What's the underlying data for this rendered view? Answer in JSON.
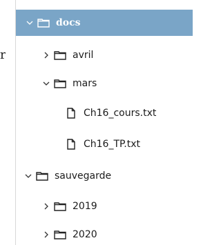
{
  "stray_text": "r",
  "tree": {
    "items": [
      {
        "label": "docs",
        "icon": "folder-icon",
        "chevron": "chevron-down-icon"
      },
      {
        "label": "avril",
        "icon": "folder-icon",
        "chevron": "chevron-right-icon"
      },
      {
        "label": "mars",
        "icon": "folder-icon",
        "chevron": "chevron-down-icon"
      },
      {
        "label": "Ch16_cours.txt",
        "icon": "file-icon"
      },
      {
        "label": "Ch16_TP.txt",
        "icon": "file-icon"
      },
      {
        "label": "sauvegarde",
        "icon": "folder-icon",
        "chevron": "chevron-down-icon"
      },
      {
        "label": "2019",
        "icon": "folder-icon",
        "chevron": "chevron-right-icon"
      },
      {
        "label": "2020",
        "icon": "folder-icon",
        "chevron": "chevron-right-icon"
      }
    ]
  },
  "colors": {
    "selection": "#7aa5c7",
    "text": "#1b1b1b",
    "selected_text": "#ffffff"
  }
}
